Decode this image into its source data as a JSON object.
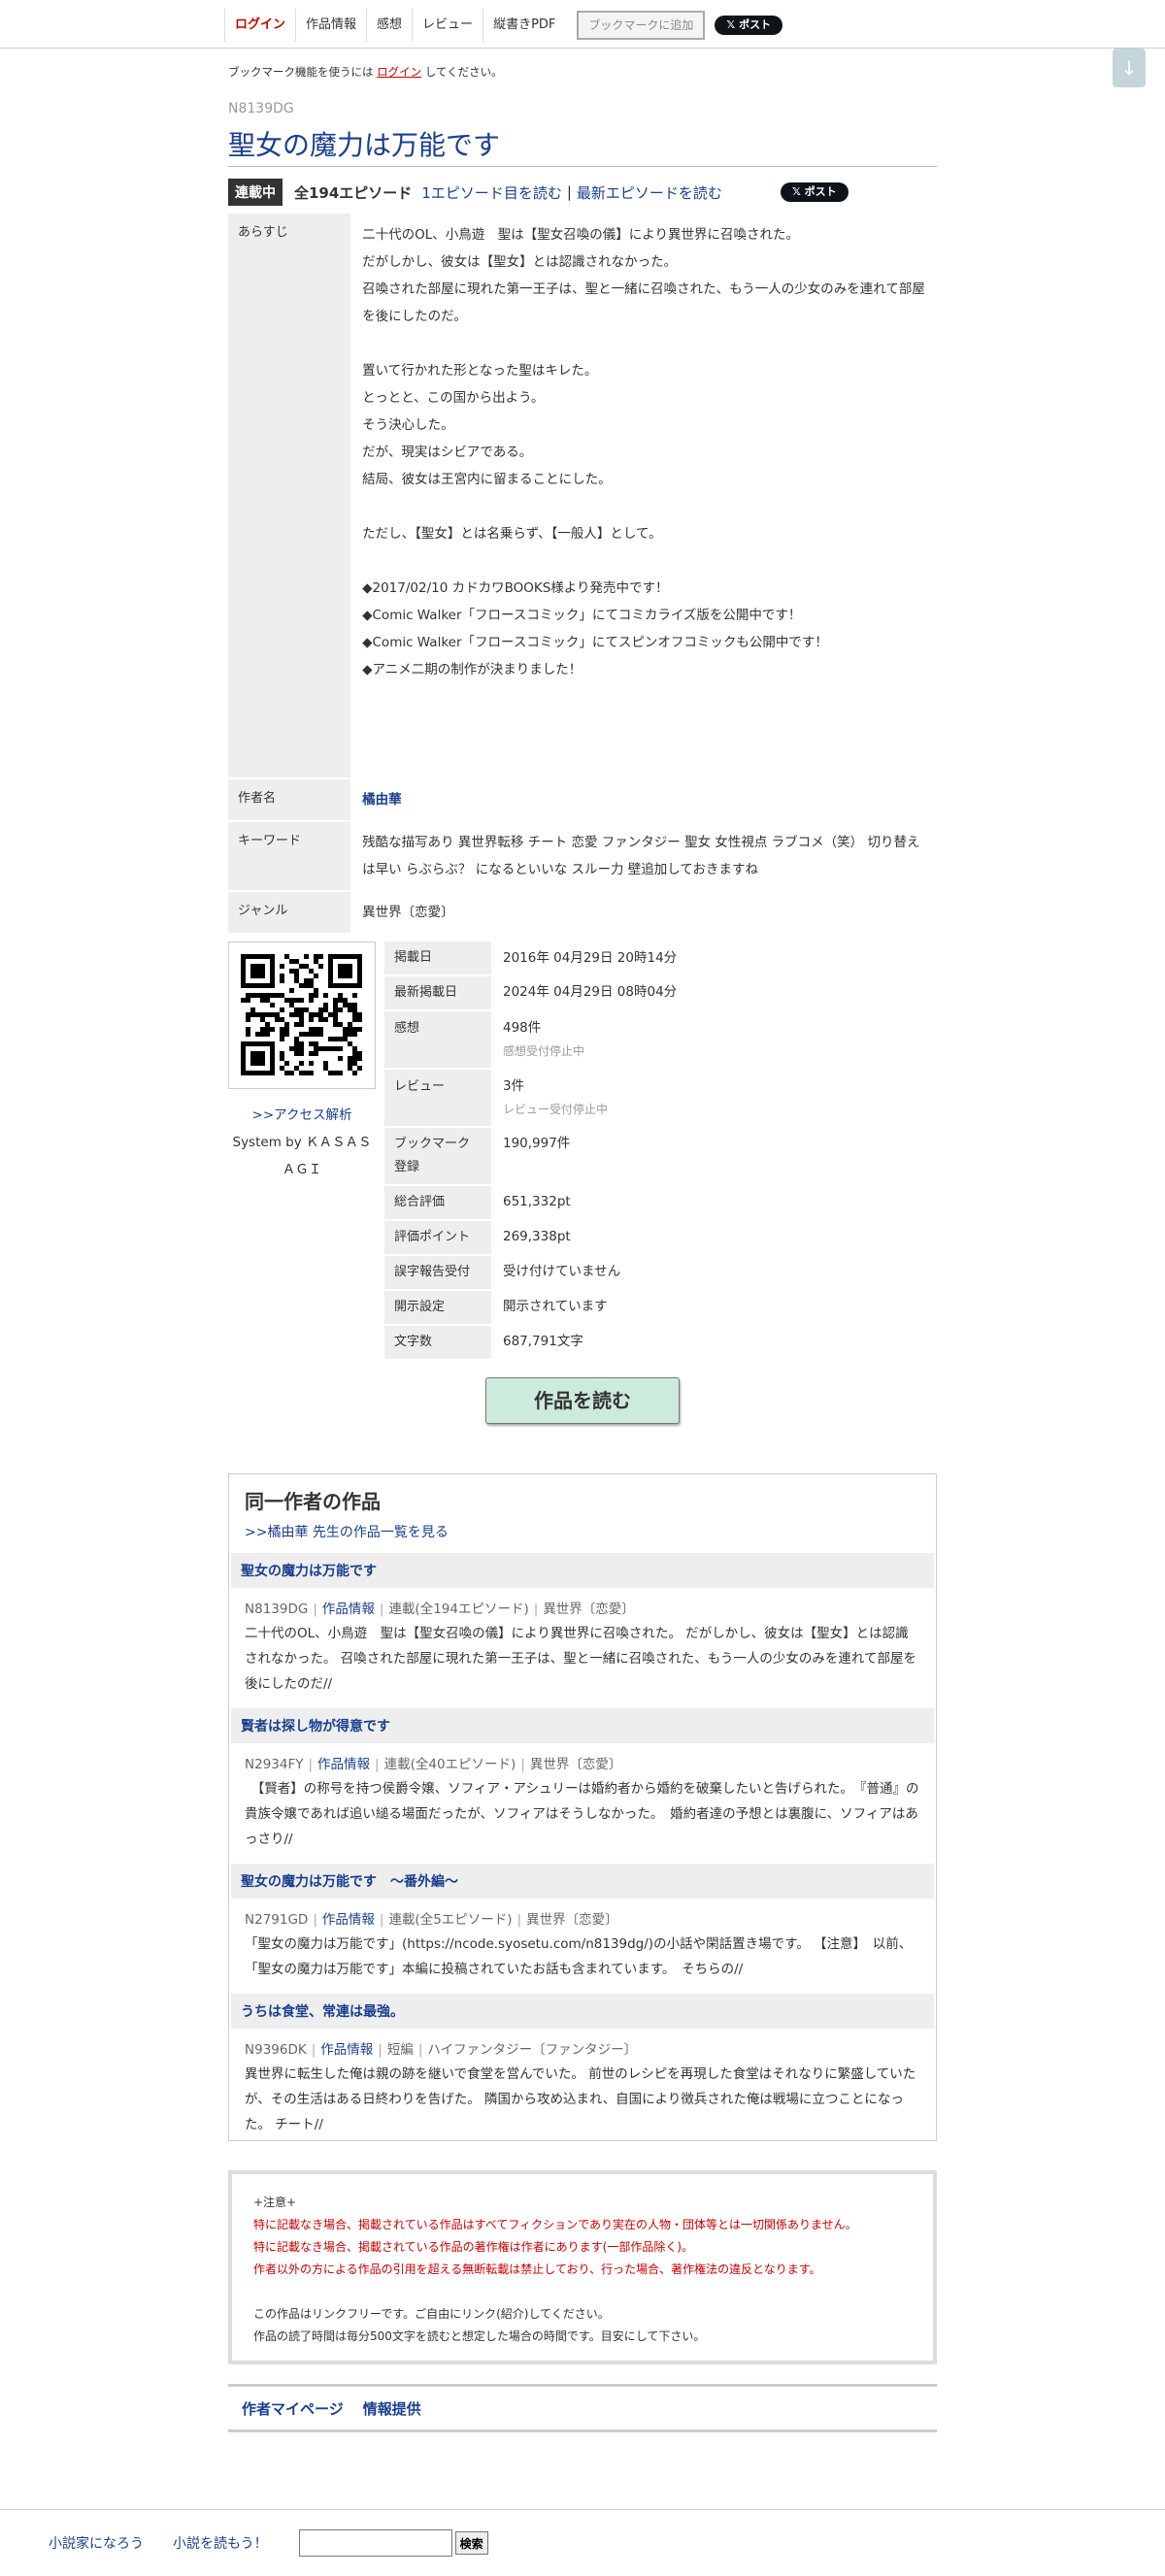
{
  "nav": {
    "login": "ログイン",
    "info": "作品情報",
    "impressions": "感想",
    "review": "レビュー",
    "pdf": "縦書きPDF",
    "bookmark": "ブックマークに追加",
    "post": "ポスト"
  },
  "bookmark_note": {
    "pre": "ブックマーク機能を使うには",
    "link": "ログイン",
    "post": "してください。"
  },
  "work": {
    "ncode": "N8139DG",
    "title": "聖女の魔力は万能です",
    "status": "連載中",
    "episodes": "全194エピソード",
    "first_link": "1エピソード目を読む",
    "separator": "|",
    "latest_link": "最新エピソードを読む",
    "post": "ポスト"
  },
  "info": {
    "synopsis_label": "あらすじ",
    "synopsis": "二十代のOL、小鳥遊　聖は【聖女召喚の儀】により異世界に召喚された。\nだがしかし、彼女は【聖女】とは認識されなかった。\n召喚された部屋に現れた第一王子は、聖と一緒に召喚された、もう一人の少女のみを連れて部屋を後にしたのだ。\n\n置いて行かれた形となった聖はキレた。\nとっとと、この国から出よう。\nそう決心した。\nだが、現実はシビアである。\n結局、彼女は王宮内に留まることにした。\n\nただし、【聖女】とは名乗らず、【一般人】として。\n\n◆2017/02/10 カドカワBOOKS様より発売中です！\n◆Comic Walker「フロースコミック」にてコミカライズ版を公開中です！\n◆Comic Walker「フロースコミック」にてスピンオフコミックも公開中です！\n◆アニメ二期の制作が決まりました！",
    "author_label": "作者名",
    "author": "橘由華",
    "keyword_label": "キーワード",
    "keywords": "残酷な描写あり 異世界転移 チート 恋愛 ファンタジー 聖女 女性視点 ラブコメ（笑） 切り替えは早い らぶらぶ？ になるといいな スルー力 壁追加しておきますね",
    "genre_label": "ジャンル",
    "genre": "異世界〔恋愛〕"
  },
  "access": {
    "link": ">>アクセス解析",
    "system": "System by ＫＡＳＡＳＡＧＩ"
  },
  "stats": [
    {
      "label": "掲載日",
      "value": "2016年 04月29日 20時14分",
      "sub": ""
    },
    {
      "label": "最新掲載日",
      "value": "2024年 04月29日 08時04分",
      "sub": ""
    },
    {
      "label": "感想",
      "value": "498件",
      "sub": "感想受付停止中"
    },
    {
      "label": "レビュー",
      "value": "3件",
      "sub": "レビュー受付停止中"
    },
    {
      "label": "ブックマーク登録",
      "value": "190,997件",
      "sub": ""
    },
    {
      "label": "総合評価",
      "value": "651,332pt",
      "sub": ""
    },
    {
      "label": "評価ポイント",
      "value": "269,338pt",
      "sub": ""
    },
    {
      "label": "誤字報告受付",
      "value": "受け付けていません",
      "sub": ""
    },
    {
      "label": "開示設定",
      "value": "開示されています",
      "sub": ""
    },
    {
      "label": "文字数",
      "value": "687,791文字",
      "sub": ""
    }
  ],
  "read_button": "作品を読む",
  "same_author": {
    "heading": "同一作者の作品",
    "see_all": ">>橘由華 先生の作品一覧を見る",
    "works": [
      {
        "title": "聖女の魔力は万能です",
        "ncode": "N8139DG",
        "info": "作品情報",
        "type": "連載(全194エピソード)",
        "genre": "異世界〔恋愛〕",
        "summary": "二十代のOL、小鳥遊　聖は【聖女召喚の儀】により異世界に召喚された。 だがしかし、彼女は【聖女】とは認識されなかった。 召喚された部屋に現れた第一王子は、聖と一緒に召喚された、もう一人の少女のみを連れて部屋を後にしたのだ//"
      },
      {
        "title": "賢者は探し物が得意です",
        "ncode": "N2934FY",
        "info": "作品情報",
        "type": "連載(全40エピソード)",
        "genre": "異世界〔恋愛〕",
        "summary": "　【賢者】の称号を持つ侯爵令嬢、ソフィア・アシュリーは婚約者から婚約を破棄したいと告げられた。　『普通』の貴族令嬢であれば追い縋る場面だったが、ソフィアはそうしなかった。　婚約者達の予想とは裏腹に、ソフィアはあっさり//"
      },
      {
        "title": "聖女の魔力は万能です　～番外編～",
        "ncode": "N2791GD",
        "info": "作品情報",
        "type": "連載(全5エピソード)",
        "genre": "異世界〔恋愛〕",
        "summary": "「聖女の魔力は万能です」(https://ncode.syosetu.com/n8139dg/)の小話や閑話置き場です。 【注意】　以前、「聖女の魔力は万能です」本編に投稿されていたお話も含まれています。　そちらの//"
      },
      {
        "title": "うちは食堂、常連は最強。",
        "ncode": "N9396DK",
        "info": "作品情報",
        "type": "短編",
        "genre": "ハイファンタジー〔ファンタジー〕",
        "summary": "異世界に転生した俺は親の跡を継いで食堂を営んでいた。 前世のレシピを再現した食堂はそれなりに繁盛していたが、その生活はある日終わりを告げた。 隣国から攻め込まれ、自国により徴兵された俺は戦場に立つことになった。 チート//"
      }
    ]
  },
  "notice": {
    "head": "+注意+",
    "red1": "特に記載なき場合、掲載されている作品はすべてフィクションであり実在の人物・団体等とは一切関係ありません。",
    "red2": "特に記載なき場合、掲載されている作品の著作権は作者にあります(一部作品除く)。",
    "red3": "作者以外の方による作品の引用を超える無断転載は禁止しており、行った場合、著作権法の違反となります。",
    "line1": "この作品はリンクフリーです。ご自由にリンク(紹介)してください。",
    "line2": "作品の読了時間は毎分500文字を読むと想定した場合の時間です。目安にして下さい。"
  },
  "author_links": {
    "mypage": "作者マイページ",
    "report": "情報提供"
  },
  "footer": {
    "site": "小説家になろう",
    "read": "小説を読もう！",
    "search_button": "検索"
  },
  "colors": {
    "link": "#1a3f8f",
    "login": "#cc0000",
    "read_button": "#cdebdc"
  }
}
